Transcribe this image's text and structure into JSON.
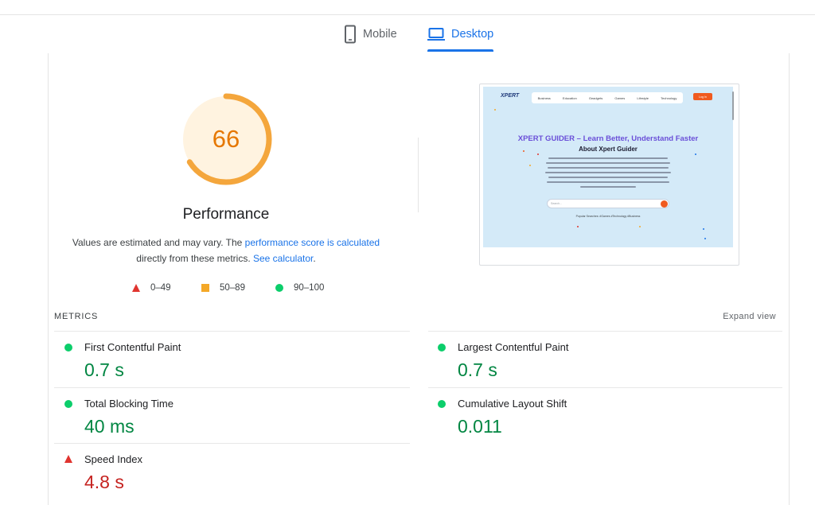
{
  "tabs": [
    {
      "label": "Mobile",
      "icon": "phone-icon",
      "active": false
    },
    {
      "label": "Desktop",
      "icon": "laptop-icon",
      "active": true
    }
  ],
  "score": {
    "value": "66",
    "fraction": 0.66,
    "title": "Performance",
    "color": "#e67700"
  },
  "description": {
    "text1": "Values are estimated and may vary. The ",
    "link1": "performance score is calculated",
    "text2": " directly from these metrics. ",
    "link2": "See calculator",
    "text3": "."
  },
  "legend": [
    {
      "icon": "fail-triangle-icon",
      "range": "0–49"
    },
    {
      "icon": "average-square-icon",
      "range": "50–89"
    },
    {
      "icon": "pass-circle-icon",
      "range": "90–100"
    }
  ],
  "screenshot": {
    "logo": "XPERT",
    "nav_items": [
      "Business",
      "Education",
      "Geadgets",
      "Games",
      "Lifestyle",
      "Technology"
    ],
    "button": "Log In",
    "headline": "XPERT GUIDER – Learn Better, Understand Faster",
    "subheading": "About Xpert Guider",
    "search_placeholder": "Search...",
    "popular": "Popular Searches:  #Games   #Technology   #Business"
  },
  "metrics_section": {
    "label": "METRICS",
    "expand_label": "Expand view"
  },
  "metrics": [
    {
      "name": "First Contentful Paint",
      "value": "0.7 s",
      "status": "pass"
    },
    {
      "name": "Largest Contentful Paint",
      "value": "0.7 s",
      "status": "pass"
    },
    {
      "name": "Total Blocking Time",
      "value": "40 ms",
      "status": "pass"
    },
    {
      "name": "Cumulative Layout Shift",
      "value": "0.011",
      "status": "pass"
    },
    {
      "name": "Speed Index",
      "value": "4.8 s",
      "status": "fail"
    }
  ],
  "colors": {
    "accent": "#1a73e8",
    "pass": "#0cce6b",
    "pass_text": "#018642",
    "average": "#f4a828",
    "fail": "#e0342f",
    "fail_text": "#c5221f"
  }
}
